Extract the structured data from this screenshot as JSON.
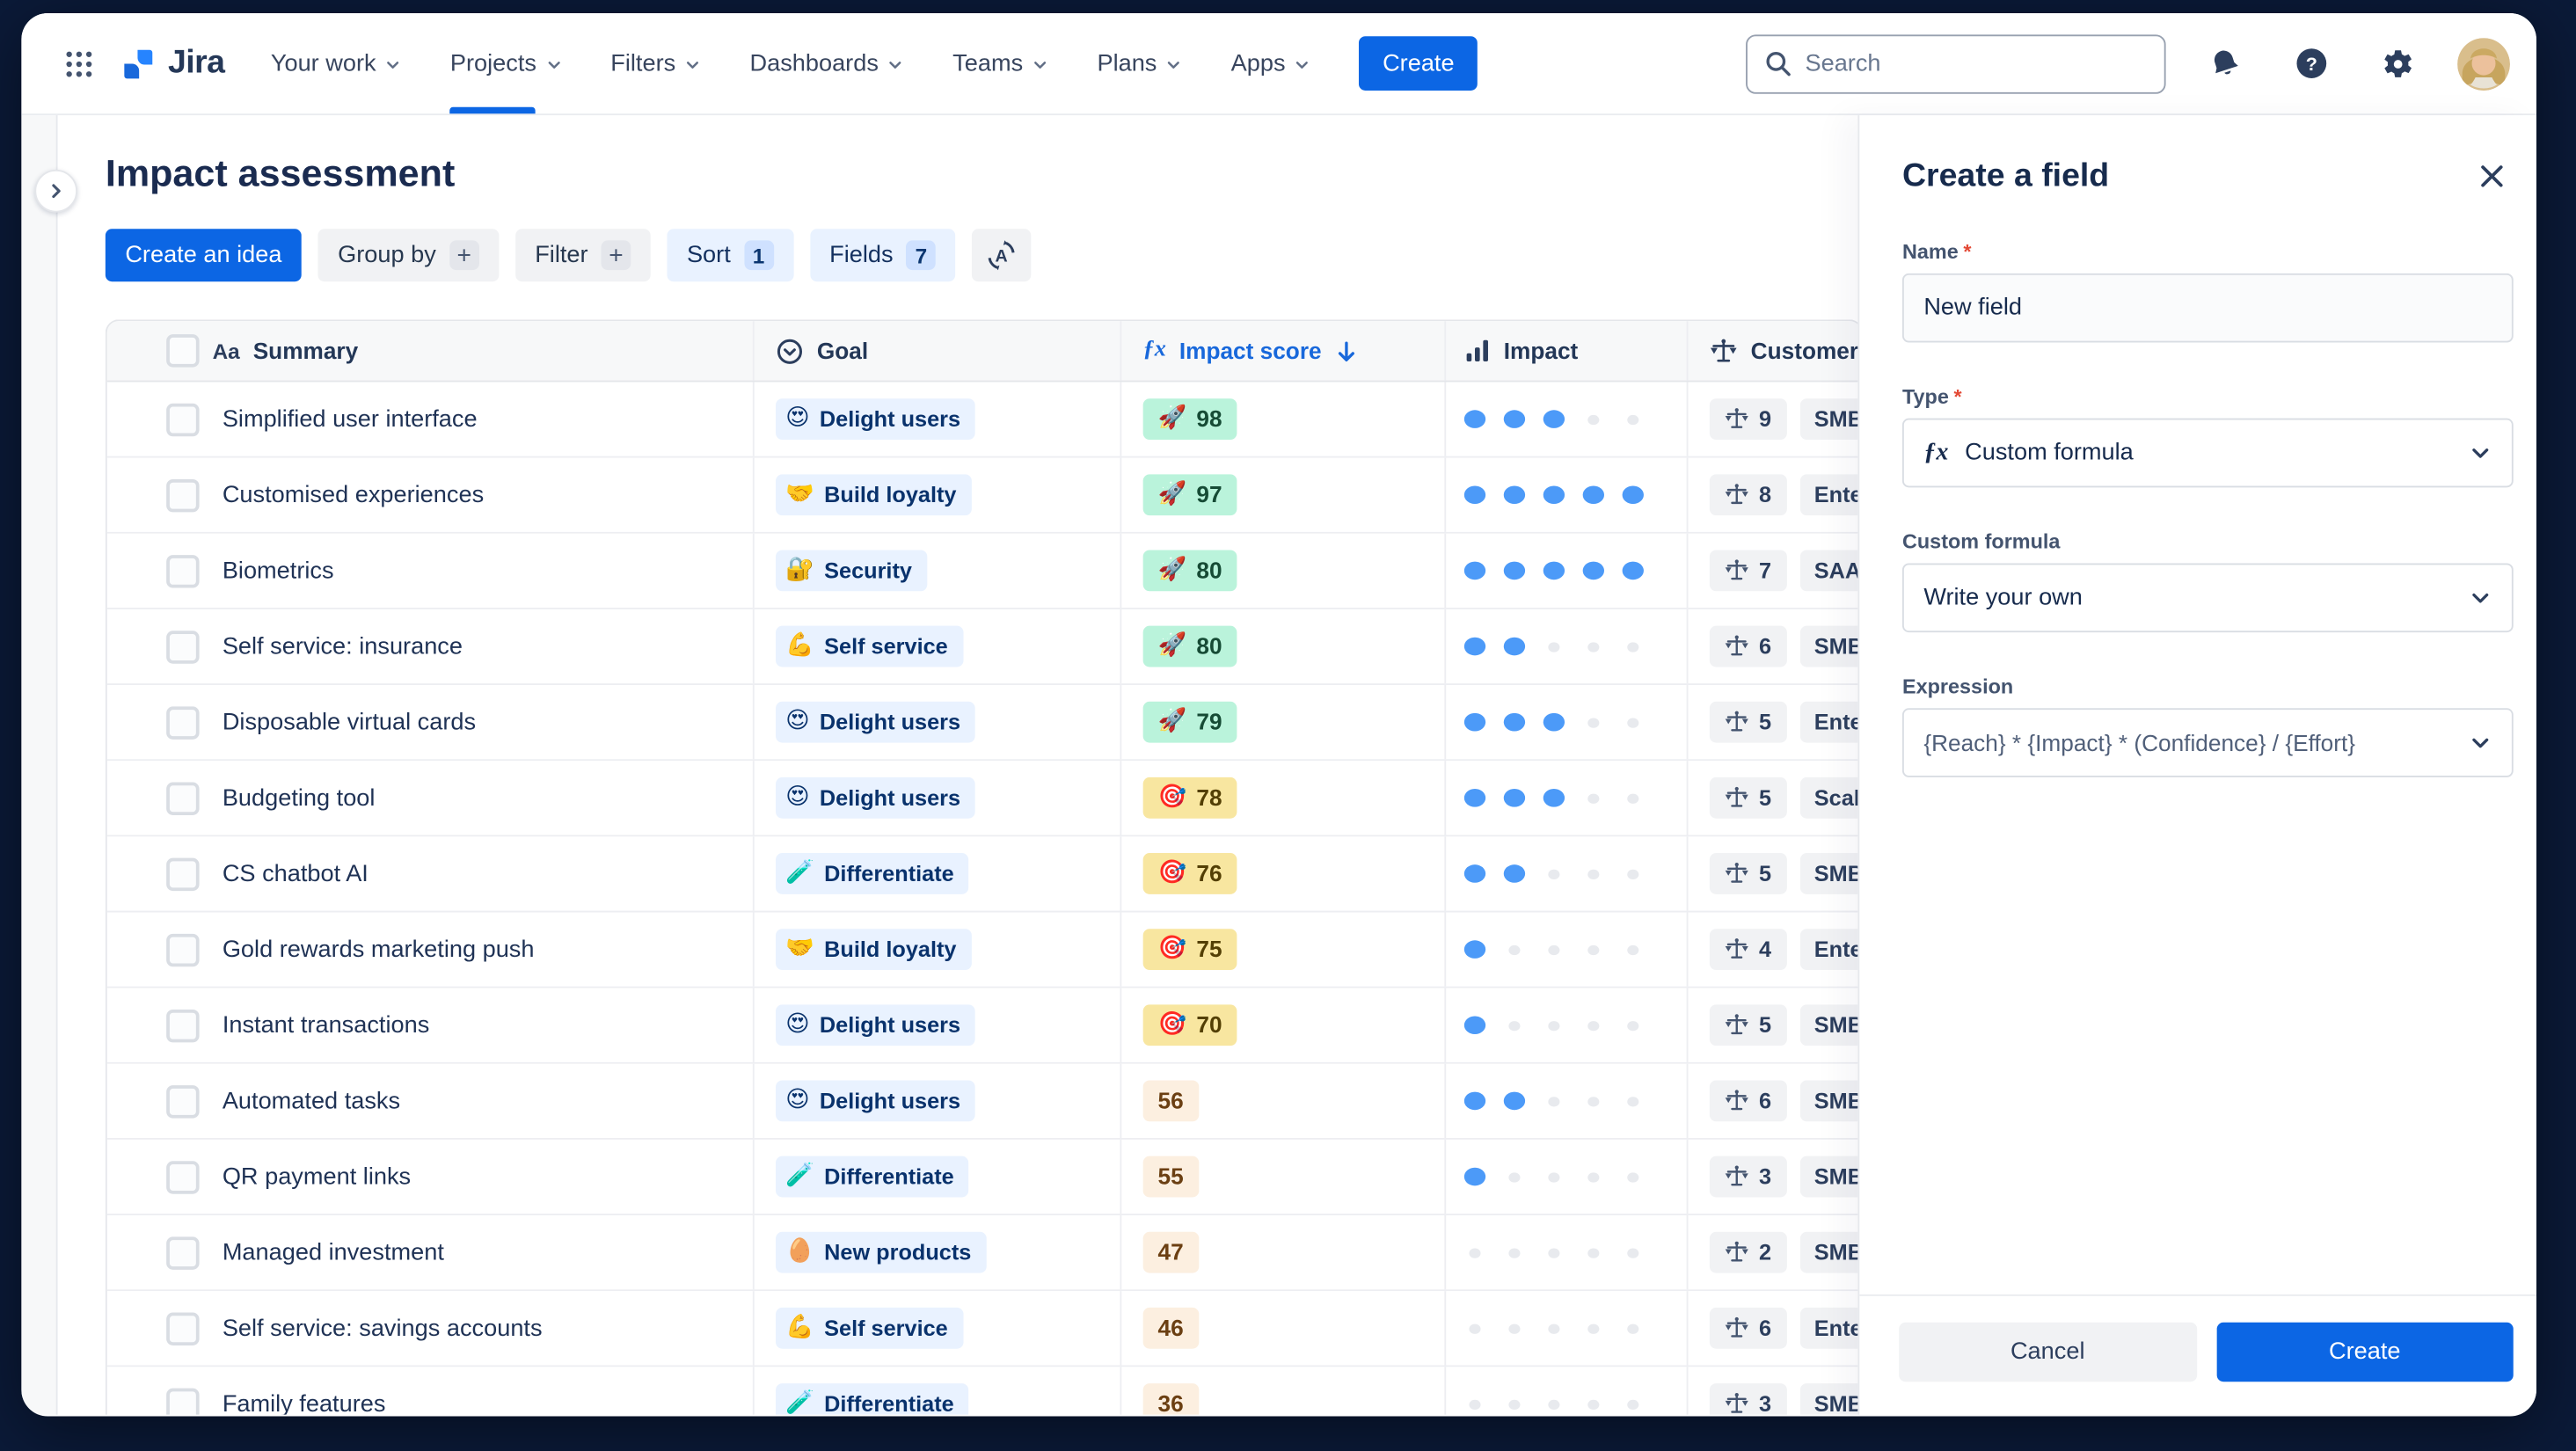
{
  "nav": {
    "logo_text": "Jira",
    "items": [
      {
        "label": "Your work"
      },
      {
        "label": "Projects"
      },
      {
        "label": "Filters"
      },
      {
        "label": "Dashboards"
      },
      {
        "label": "Teams"
      },
      {
        "label": "Plans"
      },
      {
        "label": "Apps"
      }
    ],
    "active_item": "Projects",
    "create_label": "Create",
    "search_placeholder": "Search"
  },
  "page": {
    "title": "Impact assessment",
    "toolbar": {
      "create_idea": "Create an idea",
      "group_by": "Group by",
      "group_by_badge": "+",
      "filter": "Filter",
      "filter_badge": "+",
      "sort": "Sort",
      "sort_badge": "1",
      "fields": "Fields",
      "fields_badge": "7",
      "alphabetize_icon": "sort-alpha-icon"
    }
  },
  "table": {
    "columns": [
      {
        "label": "Summary",
        "icon": "text-style-icon"
      },
      {
        "label": "Goal",
        "icon": "select-chevron-icon"
      },
      {
        "label": "Impact score",
        "icon": "formula-fx-icon",
        "sort": "descending"
      },
      {
        "label": "Impact",
        "icon": "bar-chart-icon"
      },
      {
        "label": "Customer",
        "icon": "scale-icon"
      }
    ],
    "rows": [
      {
        "summary": "Simplified user interface",
        "goal": {
          "emoji": "😍",
          "label": "Delight users"
        },
        "score": {
          "emoji": "🚀",
          "value": "98",
          "tone": "green"
        },
        "impact": 3,
        "customer": {
          "count": "9",
          "segment": "SMB"
        }
      },
      {
        "summary": "Customised experiences",
        "goal": {
          "emoji": "🤝",
          "label": "Build loyalty"
        },
        "score": {
          "emoji": "🚀",
          "value": "97",
          "tone": "green"
        },
        "impact": 5,
        "customer": {
          "count": "8",
          "segment": "Enter"
        }
      },
      {
        "summary": "Biometrics",
        "goal": {
          "emoji": "🔐",
          "label": "Security"
        },
        "score": {
          "emoji": "🚀",
          "value": "80",
          "tone": "green"
        },
        "impact": 5,
        "customer": {
          "count": "7",
          "segment": "SAAS"
        }
      },
      {
        "summary": "Self service: insurance",
        "goal": {
          "emoji": "💪",
          "label": "Self service"
        },
        "score": {
          "emoji": "🚀",
          "value": "80",
          "tone": "green"
        },
        "impact": 2,
        "customer": {
          "count": "6",
          "segment": "SMB"
        }
      },
      {
        "summary": "Disposable virtual cards",
        "goal": {
          "emoji": "😍",
          "label": "Delight users"
        },
        "score": {
          "emoji": "🚀",
          "value": "79",
          "tone": "green"
        },
        "impact": 3,
        "customer": {
          "count": "5",
          "segment": "Enterp"
        }
      },
      {
        "summary": "Budgeting tool",
        "goal": {
          "emoji": "😍",
          "label": "Delight users"
        },
        "score": {
          "emoji": "🎯",
          "value": "78",
          "tone": "yellow"
        },
        "impact": 3,
        "customer": {
          "count": "5",
          "segment": "Scale"
        }
      },
      {
        "summary": "CS chatbot AI",
        "goal": {
          "emoji": "🧪",
          "label": "Differentiate"
        },
        "score": {
          "emoji": "🎯",
          "value": "76",
          "tone": "yellow"
        },
        "impact": 2,
        "customer": {
          "count": "5",
          "segment": "SMB"
        }
      },
      {
        "summary": "Gold rewards marketing push",
        "goal": {
          "emoji": "🤝",
          "label": "Build loyalty"
        },
        "score": {
          "emoji": "🎯",
          "value": "75",
          "tone": "yellow"
        },
        "impact": 1,
        "customer": {
          "count": "4",
          "segment": "Enter"
        }
      },
      {
        "summary": "Instant transactions",
        "goal": {
          "emoji": "😍",
          "label": "Delight users"
        },
        "score": {
          "emoji": "🎯",
          "value": "70",
          "tone": "yellow"
        },
        "impact": 1,
        "customer": {
          "count": "5",
          "segment": "SMB"
        }
      },
      {
        "summary": "Automated tasks",
        "goal": {
          "emoji": "😍",
          "label": "Delight users"
        },
        "score": {
          "emoji": "",
          "value": "56",
          "tone": "peach"
        },
        "impact": 2,
        "customer": {
          "count": "6",
          "segment": "SMB"
        }
      },
      {
        "summary": "QR payment links",
        "goal": {
          "emoji": "🧪",
          "label": "Differentiate"
        },
        "score": {
          "emoji": "",
          "value": "55",
          "tone": "peach"
        },
        "impact": 1,
        "customer": {
          "count": "3",
          "segment": "SMB"
        }
      },
      {
        "summary": "Managed investment",
        "goal": {
          "emoji": "🥚",
          "label": "New products"
        },
        "score": {
          "emoji": "",
          "value": "47",
          "tone": "peach"
        },
        "impact": 0,
        "customer": {
          "count": "2",
          "segment": "SMB"
        }
      },
      {
        "summary": "Self service: savings accounts",
        "goal": {
          "emoji": "💪",
          "label": "Self service"
        },
        "score": {
          "emoji": "",
          "value": "46",
          "tone": "peach"
        },
        "impact": 0,
        "customer": {
          "count": "6",
          "segment": "Enter"
        }
      },
      {
        "summary": "Family features",
        "goal": {
          "emoji": "🧪",
          "label": "Differentiate"
        },
        "score": {
          "emoji": "",
          "value": "36",
          "tone": "peach"
        },
        "impact": 0,
        "customer": {
          "count": "3",
          "segment": "SMB"
        }
      }
    ],
    "impact_dots_max": 5
  },
  "panel": {
    "title": "Create a field",
    "name_label": "Name",
    "name_value": "New field",
    "type_label": "Type",
    "type_value": "Custom formula",
    "custom_formula_label": "Custom formula",
    "custom_formula_value": "Write your own",
    "expression_label": "Expression",
    "expression_value": "{Reach} * {Impact} * (Confidence} / {Effort}",
    "cancel_label": "Cancel",
    "create_label": "Create"
  },
  "colors": {
    "accent_blue": "#0C66E4",
    "link_blue": "#1868DB",
    "navy_text": "#172B4D",
    "chip_blue_bg": "#E9F2FF",
    "chip_green_bg": "#BAF3DB",
    "chip_yellow_bg": "#F8E6A0",
    "chip_peach_bg": "#FCEFE0",
    "dot_filled": "#4C9AF8",
    "backdrop": "#0B1A38"
  }
}
